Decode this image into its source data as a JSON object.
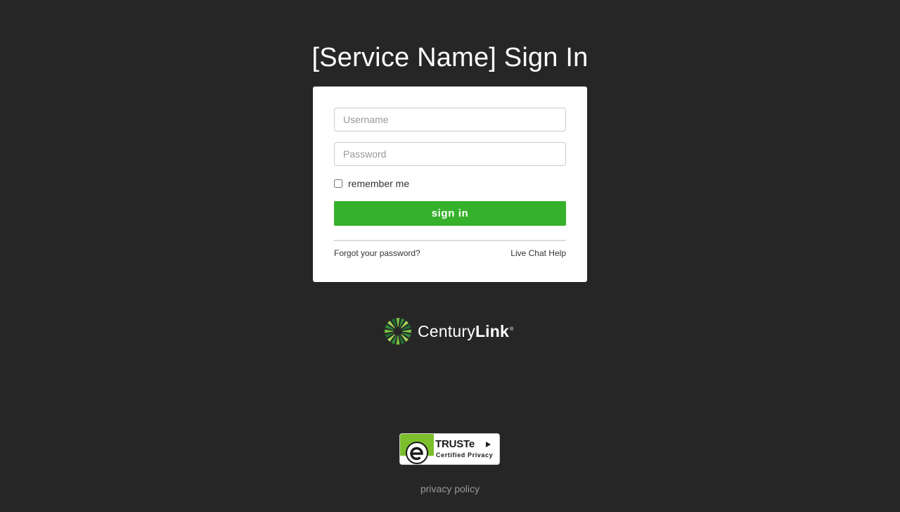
{
  "header": {
    "title": "[Service Name] Sign In"
  },
  "form": {
    "username_placeholder": "Username",
    "password_placeholder": "Password",
    "remember_label": "remember me",
    "remember_checked": false,
    "submit_label": "sign in",
    "forgot_link": "Forgot your password?",
    "help_link": "Live Chat Help"
  },
  "brand": {
    "name_light": "Century",
    "name_bold": "Link",
    "registered": "®",
    "icon": "centurylink-logo-icon"
  },
  "seal": {
    "name": "TRUSTe",
    "subtitle": "Certified Privacy",
    "icon": "truste-seal-icon"
  },
  "footer": {
    "privacy_link": "privacy policy"
  },
  "colors": {
    "background": "#262626",
    "accent": "#36b12b",
    "card": "#ffffff",
    "seal_green": "#7cbe2c"
  }
}
